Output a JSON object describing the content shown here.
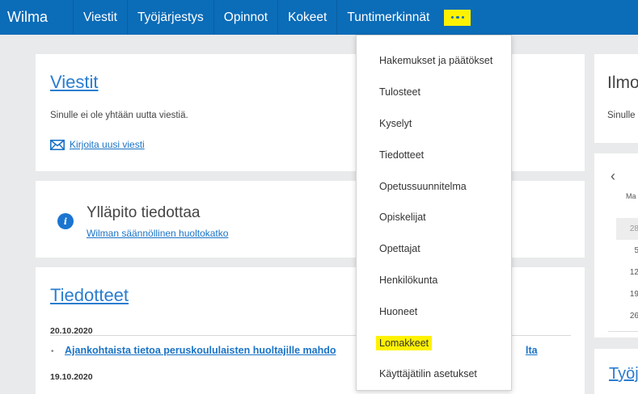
{
  "topbar": {
    "brand": "Wilma",
    "nav": [
      "Viestit",
      "Työjärjestys",
      "Opinnot",
      "Kokeet",
      "Tuntimerkinnät"
    ],
    "more_label": "more-menu"
  },
  "messages_card": {
    "title": "Viestit",
    "empty_text": "Sinulle ei ole yhtään uutta viestiä.",
    "compose_link": "Kirjoita uusi viesti"
  },
  "admin_card": {
    "heading": "Ylläpito tiedottaa",
    "link": "Wilman säännöllinen huoltokatko"
  },
  "announcements_card": {
    "title": "Tiedotteet",
    "items": [
      {
        "date": "20.10.2020",
        "title": "Ajankohtaista tietoa peruskoululaisten huoltajille mahdo",
        "title_tail": "lta"
      },
      {
        "date": "19.10.2020"
      }
    ]
  },
  "right_column": {
    "notice_title": "Ilmo",
    "notice_text": "Sinulle",
    "calendar": {
      "prev_label": "‹",
      "weekday": "Ma",
      "days": [
        "28",
        "5",
        "12",
        "19",
        "26"
      ]
    },
    "schedule_title": "Työj"
  },
  "dropdown": {
    "items": [
      "Hakemukset ja päätökset",
      "Tulosteet",
      "Kyselyt",
      "Tiedotteet",
      "Opetussuunnitelma",
      "Opiskelijat",
      "Opettajat",
      "Henkilökunta",
      "Huoneet",
      "Lomakkeet",
      "Käyttäjätilin asetukset"
    ],
    "highlighted": "Lomakkeet"
  },
  "colors": {
    "topbar": "#0b6cb8",
    "highlight": "#fff200",
    "link": "#1a73c6",
    "background": "#e9eaeb"
  }
}
